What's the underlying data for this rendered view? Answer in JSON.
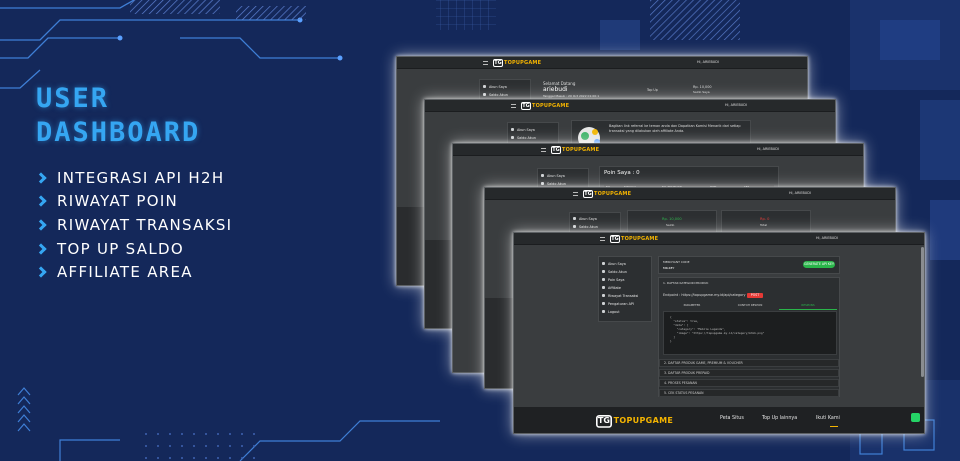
{
  "hero": {
    "title_line1": "USER",
    "title_line2": "DASHBOARD",
    "features": [
      "INTEGRASI API H2H",
      "RIWAYAT POIN",
      "RIWAYAT TRANSAKSI",
      "TOP UP SALDO",
      "AFFILIATE AREA"
    ]
  },
  "colors": {
    "background": "#14285a",
    "accent": "#35a6f2",
    "screen_bg": "#3a3d3f",
    "success": "#2ab54a",
    "danger": "#e53935",
    "brand": "#f4b400"
  },
  "brand": {
    "logo_mark": "TG",
    "logo_word": "TOPUPGAME"
  },
  "shots": {
    "s1": {
      "user": "Hi, ARIEBUDI",
      "nav": [
        "Akun Saya",
        "Saldo Akun"
      ],
      "welcome": "Selamat Datang",
      "username": "ariebudi",
      "joined": "Tanggal Masuk : 20 Oct 2022 01:00:1",
      "topup": "Top Up",
      "balance": "Rp. 10,000",
      "balance_label": "Saldo Saya"
    },
    "s2": {
      "user": "Hi, ARIEBUDI",
      "nav": [
        "Akun Saya",
        "Saldo Akun"
      ],
      "affiliate_text": "Bagikan link referral ke teman anda dan Dapatkan Komisi Menarik dari setiap transaksi yang dilakukan oleh affiliate Anda."
    },
    "s3": {
      "user": "Hi, ARIEBUDI",
      "nav": [
        "Akun Saya",
        "Saldo Akun"
      ],
      "poin": "Poin Saya : 0",
      "columns": [
        "NO",
        "TANGGAL",
        "NO. TRANSAKSI",
        "POIN",
        "KET"
      ]
    },
    "s4": {
      "user": "Hi, ARIEBUDI",
      "nav": [
        "Akun Saya",
        "Saldo Akun"
      ],
      "amount_in": "Rp. 10,000",
      "label_in": "Saldo",
      "amount_out": "Rp. 0",
      "label_out": "Total"
    },
    "s5": {
      "user": "Hi, ARIEBUDI",
      "nav": [
        "Akun Saya",
        "Saldo Akun",
        "Poin Saya",
        "Affiliate",
        "Riwayat Transaksi",
        "Pengaturan API",
        "Logout"
      ],
      "merchant_label": "MERCHANT CODE",
      "merchant_code": "MR-KEY",
      "generate_button": "GENERATE API KEY",
      "section1": "1. DAFTAR KATEGORI PRODUK",
      "endpoint": "Endpoint : https://topupgame.my.id/api/category",
      "method": "POST",
      "tabs": [
        "PARAMETER",
        "CONTOH RESPON",
        "RESPONS"
      ],
      "code_lines": [
        "{",
        "  \"status\": true,",
        "  \"data\": [",
        "    \"category\": \"Mobile Legends\",",
        "    \"image\": \"https://topupgame.my.id/category/mlbb.png\"",
        "  ]",
        "}"
      ],
      "sections": [
        "2. DAFTAR PRODUK GAME, PREMIUM & VOUCHER",
        "3. DAFTAR PRODUK PREPAID",
        "4. PROSES PESANAN",
        "5. CEK STATUS PESANAN"
      ],
      "footer_links": [
        "Peta Situs",
        "Top Up lainnya",
        "Ikuti Kami"
      ]
    }
  }
}
